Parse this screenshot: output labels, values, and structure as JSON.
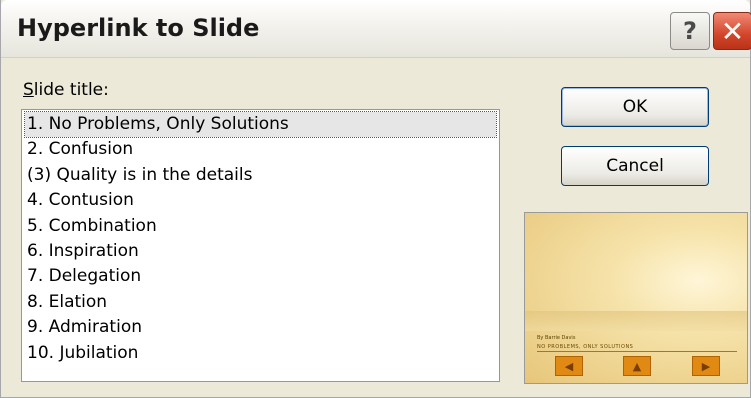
{
  "window": {
    "title": "Hyperlink to Slide",
    "help_glyph": "?",
    "close_glyph": "✕"
  },
  "slide_title_label": {
    "accel": "S",
    "rest": "lide title:"
  },
  "slides": [
    {
      "label": "1. No Problems, Only Solutions",
      "selected": true
    },
    {
      "label": "2. Confusion",
      "selected": false
    },
    {
      "label": "(3) Quality is in the details",
      "selected": false
    },
    {
      "label": "4. Contusion",
      "selected": false
    },
    {
      "label": "5. Combination",
      "selected": false
    },
    {
      "label": "6. Inspiration",
      "selected": false
    },
    {
      "label": "7. Delegation",
      "selected": false
    },
    {
      "label": "8. Elation",
      "selected": false
    },
    {
      "label": "9. Admiration",
      "selected": false
    },
    {
      "label": "10. Jubilation",
      "selected": false
    }
  ],
  "buttons": {
    "ok": "OK",
    "cancel": "Cancel"
  },
  "preview": {
    "author": "By Barrie Davis",
    "title": "NO PROBLEMS, ONLY SOLUTIONS",
    "nav_prev_glyph": "◀",
    "nav_home_glyph": "▲",
    "nav_next_glyph": "▶"
  },
  "colors": {
    "dialog_bg": "#ece9d8",
    "close_red": "#d2452b",
    "button_border": "#003c74",
    "preview_gold": "#f6e3aa",
    "nav_orange": "#e08a14"
  }
}
